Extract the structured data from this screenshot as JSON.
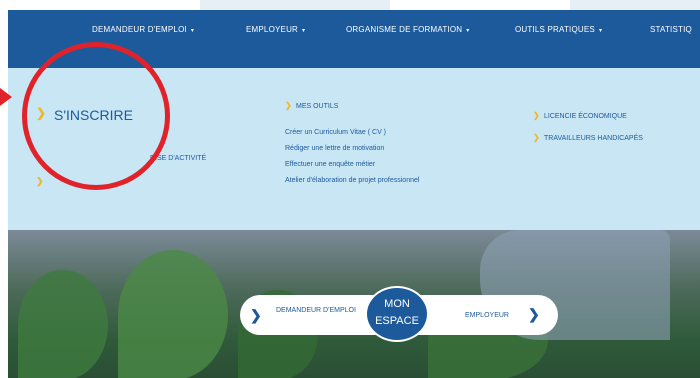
{
  "nav": {
    "items": [
      {
        "label": "DEMANDEUR D'EMPLOI",
        "caret": "▾"
      },
      {
        "label": "EMPLOYEUR",
        "caret": "▾"
      },
      {
        "label": "ORGANISME DE FORMATION",
        "caret": "▾"
      },
      {
        "label": "OUTILS PRATIQUES",
        "caret": "▾"
      },
      {
        "label": "STATISTIQ"
      }
    ]
  },
  "dropdown": {
    "main_item": "S'INSCRIRE",
    "sub_item": "RISE D'ACTIVITÉ",
    "mes_outils": {
      "title": "MES OUTILS",
      "links": [
        "Créer un Curriculum Vitae ( CV )",
        "Rédiger une lettre de motivation",
        "Effectuer une enquête métier",
        "Atelier d'élaboration de projet professionnel"
      ]
    },
    "right_column": [
      "LICENCIE ÉCONOMIQUE",
      "TRAVAILLEURS HANDICAPÉS"
    ],
    "bullet_icon": "yellow-bullet-icon"
  },
  "espace": {
    "left_label": "DEMANDEUR D'EMPLOI",
    "center_line1": "MON",
    "center_line2": "ESPACE",
    "right_label": "EMPLOYEUR",
    "left_icon": "blue-seal-icon",
    "right_icon": "blue-seal-icon"
  },
  "colors": {
    "nav_bg": "#1d5a9c",
    "dropdown_bg": "#c9e6f4",
    "accent_yellow": "#f0b828",
    "annotation_red": "#e0232a"
  }
}
